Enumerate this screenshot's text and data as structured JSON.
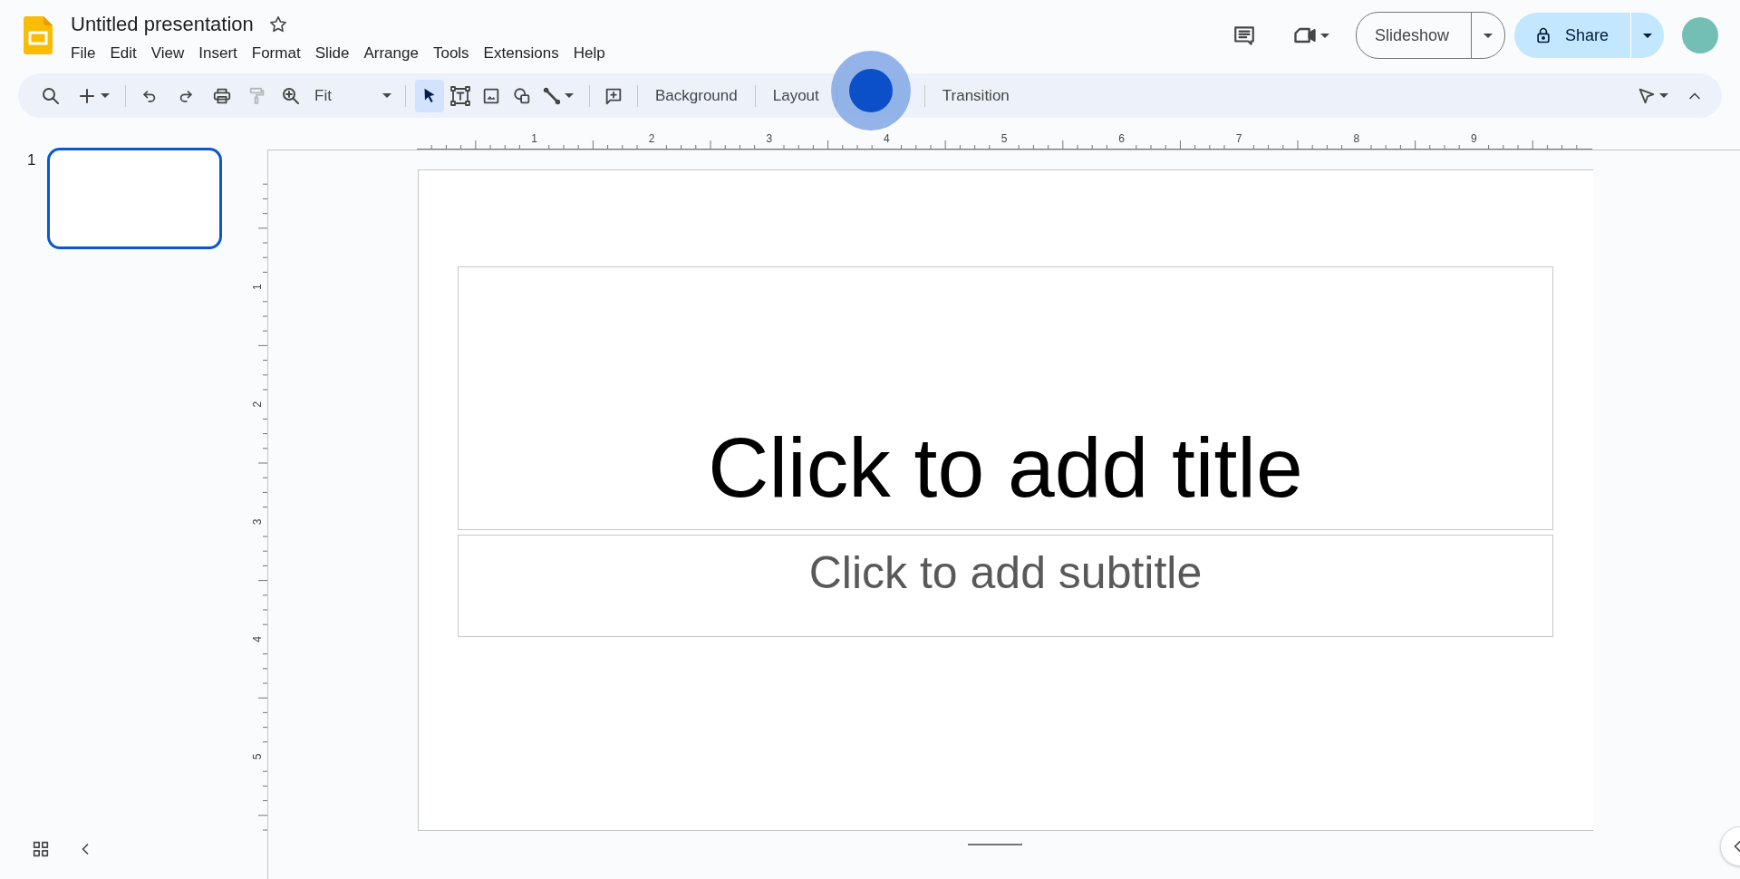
{
  "document": {
    "title": "Untitled presentation",
    "starred": false
  },
  "menu": [
    "File",
    "Edit",
    "View",
    "Insert",
    "Format",
    "Slide",
    "Arrange",
    "Tools",
    "Extensions",
    "Help"
  ],
  "header": {
    "slideshow": "Slideshow",
    "share": "Share"
  },
  "toolbar": {
    "zoom": "Fit",
    "tools": [
      {
        "kind": "select",
        "selected": true
      },
      {
        "kind": "textbox",
        "selected": false
      },
      {
        "kind": "image",
        "selected": false
      },
      {
        "kind": "shape",
        "selected": false
      },
      {
        "kind": "line",
        "selected": false
      }
    ],
    "actions": [
      "Background",
      "Layout",
      "Transition"
    ]
  },
  "slides": [
    {
      "number": "1",
      "selected": true
    }
  ],
  "rulers": {
    "horizontal": [
      "1",
      "2",
      "3",
      "4",
      "5",
      "6",
      "7",
      "8",
      "9"
    ],
    "vertical": [
      "1",
      "2",
      "3",
      "4",
      "5"
    ]
  },
  "slide": {
    "title_text": "Click to add title",
    "subtitle_text": "Click to add subtitle"
  }
}
